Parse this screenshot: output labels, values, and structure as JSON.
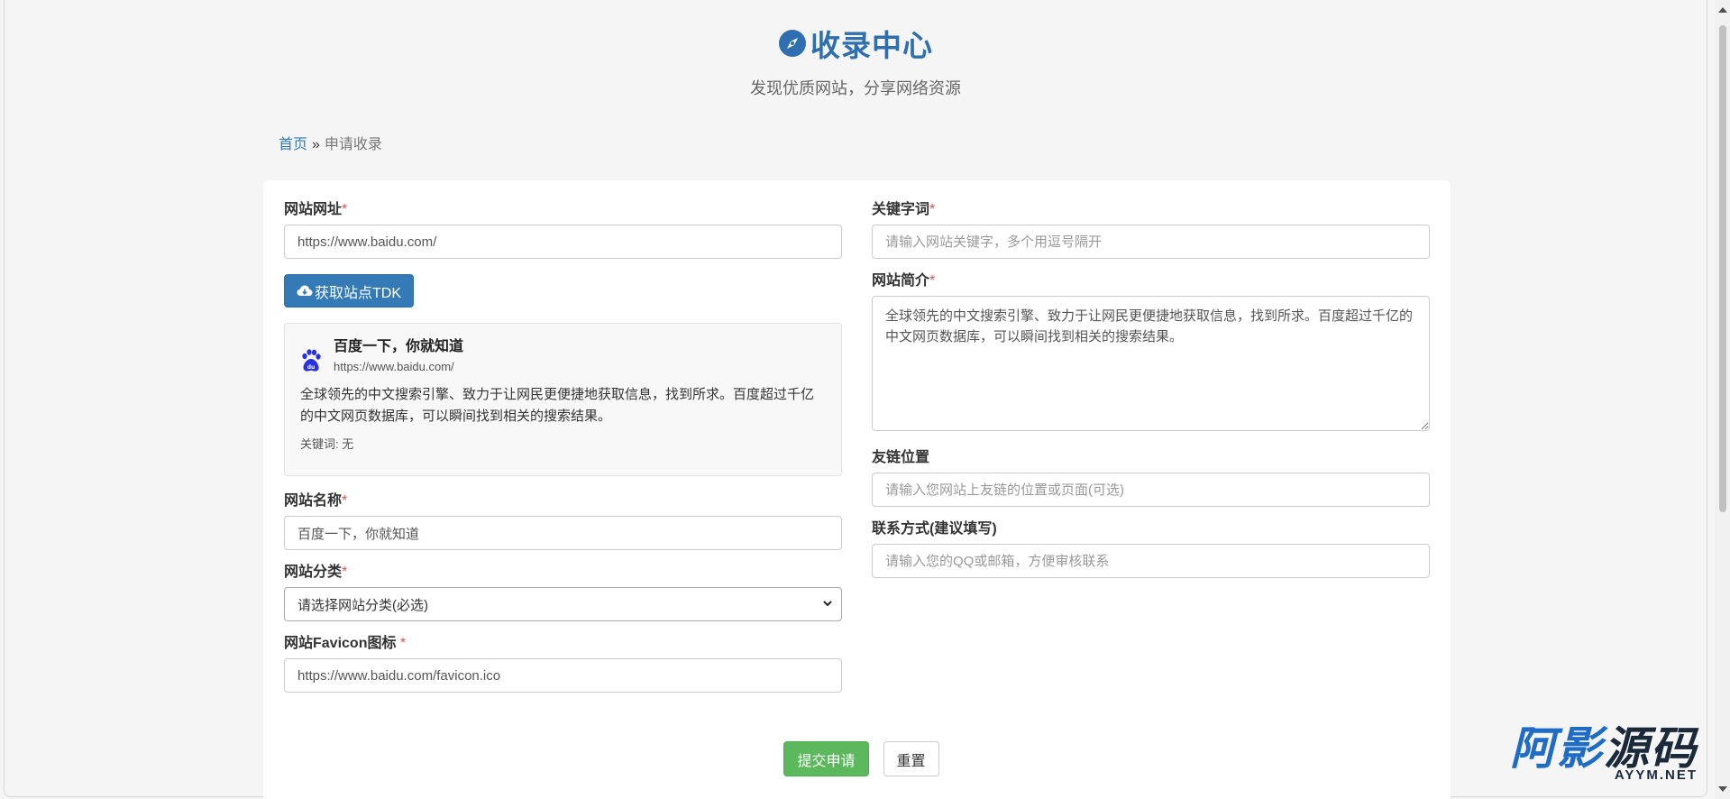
{
  "header": {
    "title": "收录中心",
    "subtitle": "发现优质网站，分享网络资源"
  },
  "breadcrumb": {
    "home": "首页",
    "separator": "»",
    "current": "申请收录"
  },
  "form": {
    "url": {
      "label": "网站网址",
      "required": "*",
      "value": "https://www.baidu.com/"
    },
    "fetch_button": "获取站点TDK",
    "preview": {
      "title": "百度一下，你就知道",
      "url": "https://www.baidu.com/",
      "description": "全球领先的中文搜索引擎、致力于让网民更便捷地获取信息，找到所求。百度超过千亿的中文网页数据库，可以瞬间找到相关的搜索结果。",
      "keywords": "关键词: 无"
    },
    "name": {
      "label": "网站名称",
      "required": "*",
      "value": "百度一下，你就知道"
    },
    "category": {
      "label": "网站分类",
      "required": "*",
      "selected": "请选择网站分类(必选)"
    },
    "favicon": {
      "label": "网站Favicon图标",
      "required": "*",
      "value": "https://www.baidu.com/favicon.ico"
    },
    "keywords": {
      "label": "关键字词",
      "required": "*",
      "placeholder": "请输入网站关键字，多个用逗号隔开"
    },
    "description": {
      "label": "网站简介",
      "required": "*",
      "value": "全球领先的中文搜索引擎、致力于让网民更便捷地获取信息，找到所求。百度超过千亿的中文网页数据库，可以瞬间找到相关的搜索结果。"
    },
    "link_position": {
      "label": "友链位置",
      "placeholder": "请输入您网站上友链的位置或页面(可选)"
    },
    "contact": {
      "label": "联系方式(建议填写)",
      "placeholder": "请输入您的QQ或邮箱，方便审核联系"
    },
    "submit_button": "提交申请",
    "reset_button": "重置"
  },
  "watermark": {
    "main_a": "阿影",
    "main_b": "源码",
    "sub": "AYYM.NET"
  },
  "colors": {
    "accent": "#337ab7",
    "title": "#2f6fb0",
    "success": "#5cb85c",
    "required": "#d9534f"
  }
}
